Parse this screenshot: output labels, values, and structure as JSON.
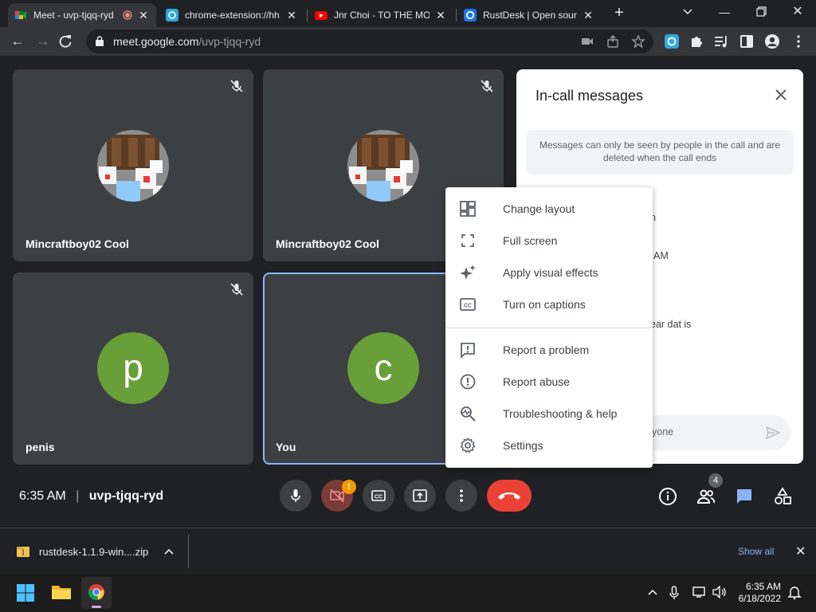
{
  "browser": {
    "tabs": [
      {
        "title": "Meet - uvp-tjqq-ryd",
        "active": true
      },
      {
        "title": "chrome-extension://hh",
        "active": false
      },
      {
        "title": "Jnr Choi - TO THE MOON",
        "active": false
      },
      {
        "title": "RustDesk | Open source",
        "active": false
      }
    ],
    "url_host": "meet.google.com",
    "url_path": "/uvp-tjqq-ryd"
  },
  "meet": {
    "participants": [
      {
        "name": "Mincraftboy02 Cool"
      },
      {
        "name": "Mincraftboy02 Cool"
      },
      {
        "name": "penis",
        "initial": "p"
      },
      {
        "name": "You",
        "initial": "c"
      }
    ],
    "time": "6:35 AM",
    "divider": "|",
    "meeting_code": "uvp-tjqq-ryd",
    "people_count": "4",
    "camera_warning": "!"
  },
  "panel": {
    "title": "In-call messages",
    "notice": "Messages can only be seen by people in the call and are deleted when the call ends",
    "fragments": [
      "n",
      "AM",
      "ear dat is"
    ],
    "placeholder": "yone"
  },
  "menu": {
    "items": [
      {
        "label": "Change layout",
        "icon": "dashboard-icon"
      },
      {
        "label": "Full screen",
        "icon": "fullscreen-icon"
      },
      {
        "label": "Apply visual effects",
        "icon": "sparkle-icon"
      },
      {
        "label": "Turn on captions",
        "icon": "captions-icon"
      },
      {
        "label": "Report a problem",
        "icon": "feedback-icon"
      },
      {
        "label": "Report abuse",
        "icon": "report-icon"
      },
      {
        "label": "Troubleshooting & help",
        "icon": "troubleshoot-icon"
      },
      {
        "label": "Settings",
        "icon": "gear-icon"
      }
    ]
  },
  "download": {
    "filename": "rustdesk-1.1.9-win....zip",
    "show_all": "Show all"
  },
  "taskbar": {
    "time": "6:35 AM",
    "date": "6/18/2022"
  },
  "colors": {
    "meet_bg": "#202124",
    "tile_bg": "#3c4043",
    "avatar_green": "#689f38",
    "end_call_red": "#ea4335",
    "accent_blue": "#8ab4f8"
  }
}
